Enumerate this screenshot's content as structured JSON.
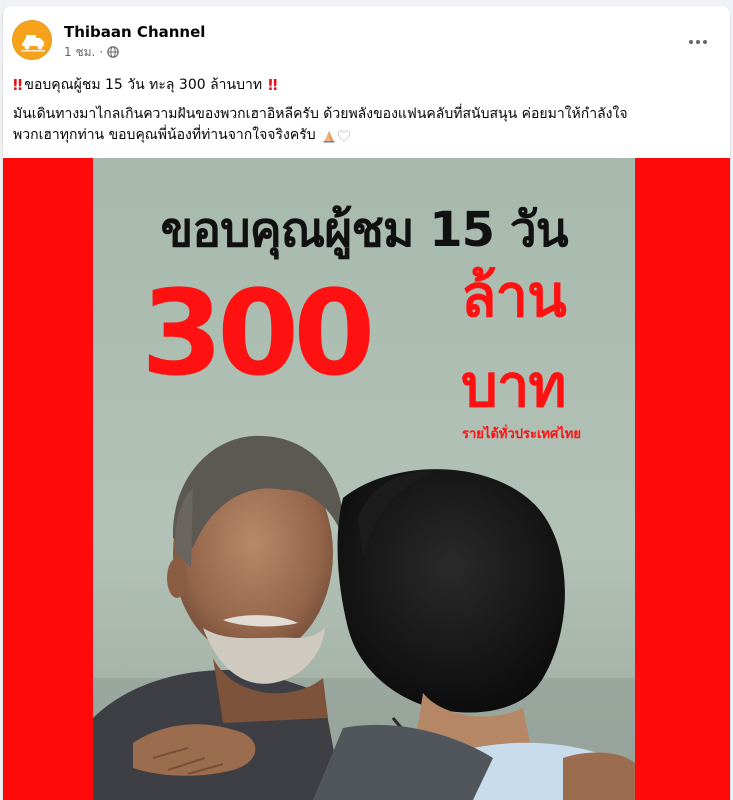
{
  "post": {
    "page_name": "Thibaan Channel",
    "time": "1 ชม.",
    "separator": "·",
    "headline": "ขอบคุณผู้ชม 15 วัน ทะลุ 300 ล้านบาท",
    "headline_marker": "‼",
    "body_line_1": "มันเดินทางมาไกลเกินความฝันของพวกเฮาอิหลีครับ ด้วยพลังของแฟนคลับที่สนับสนุน ค่อยมาให้กำลังใจ",
    "body_line_2": "พวกเฮาทุกท่าน ขอบคุณพี่น้องที่ท่านจากใจจริงครับ",
    "emoji_1": "folded-hands-icon",
    "emoji_2": "white-heart-icon"
  },
  "poster": {
    "title": "ขอบคุณผู้ชม 15 วัน",
    "big_number": "300",
    "unit_line_1": "ล้าน",
    "unit_line_2": "บาท",
    "caption": "รายได้ทั่วประเทศไทย"
  },
  "colors": {
    "accent_red": "#ff1111",
    "image_background": "#ff0a0a",
    "avatar_orange": "#f7a21b",
    "meta_gray": "#65676b"
  },
  "icons": {
    "privacy": "globe-icon",
    "menu": "more-options-icon"
  }
}
